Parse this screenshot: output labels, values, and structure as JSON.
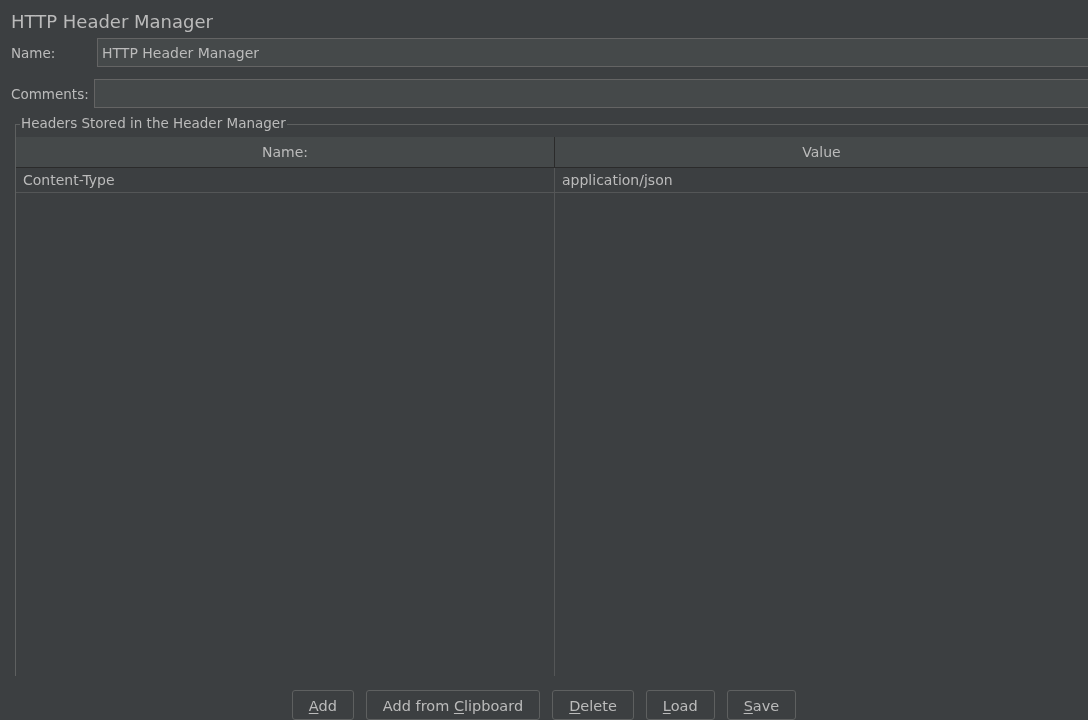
{
  "title": "HTTP Header Manager",
  "fields": [
    {
      "label": "Name:",
      "value": "HTTP Header Manager"
    },
    {
      "label": "Comments:"
    }
  ],
  "headers_panel": {
    "title": "Headers Stored in the Header Manager",
    "table": {
      "columns": [
        "Name:",
        "Value"
      ],
      "rows": [
        [
          "Content-Type",
          "application/json"
        ]
      ]
    }
  },
  "buttons": [
    {
      "mnemonic": "A",
      "after": "dd"
    },
    {
      "before": "Add from ",
      "mnemonic": "C",
      "after": "lipboard"
    },
    {
      "mnemonic": "D",
      "after": "elete"
    },
    {
      "mnemonic": "L",
      "after": "oad"
    },
    {
      "mnemonic": "S",
      "after": "ave"
    }
  ]
}
